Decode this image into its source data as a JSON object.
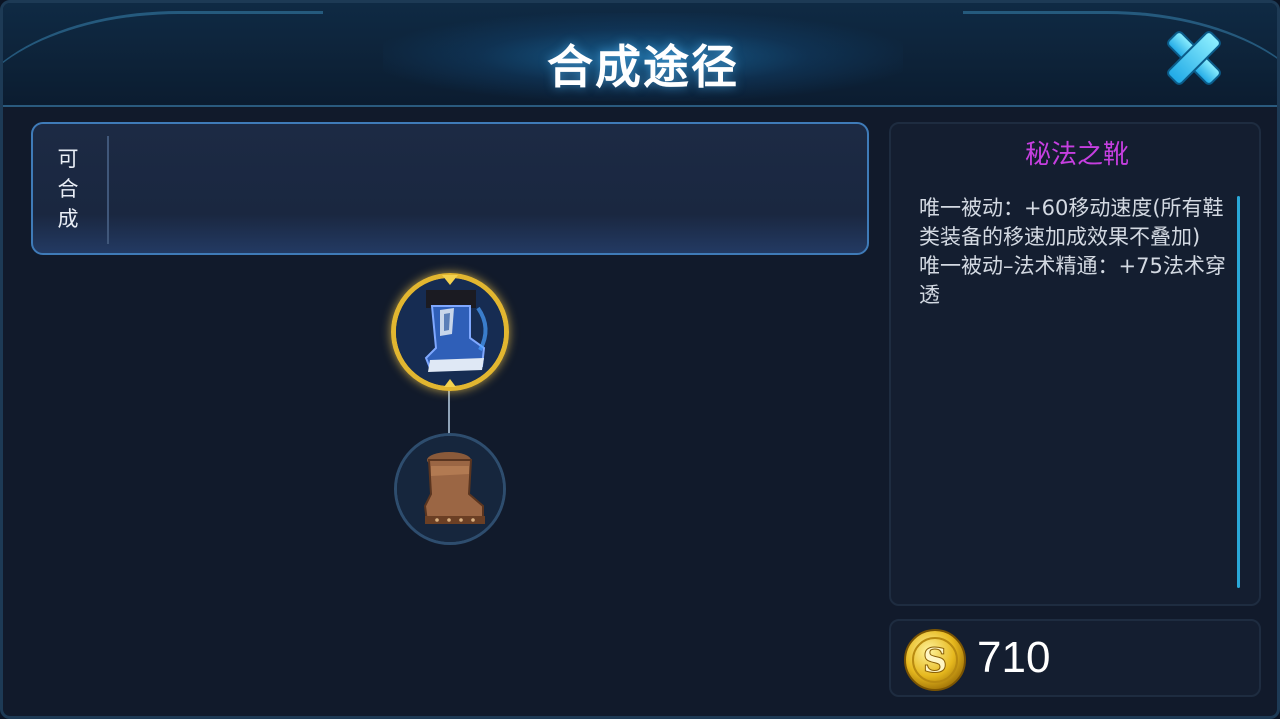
{
  "header": {
    "title": "合成途径"
  },
  "craft": {
    "label": "可合成"
  },
  "tree": {
    "main_item": "秘法之靴",
    "sub_item": "鞋子"
  },
  "detail": {
    "name": "秘法之靴",
    "description": "唯一被动：+60移动速度(所有鞋类装备的移速加成效果不叠加)\n唯一被动–法术精通：+75法术穿透",
    "name_color": "#c63fe0"
  },
  "price": {
    "value": "710",
    "icon": "gold-coin-icon"
  },
  "colors": {
    "accent": "#2aa8d8",
    "highlight_ring": "#e2b630"
  }
}
